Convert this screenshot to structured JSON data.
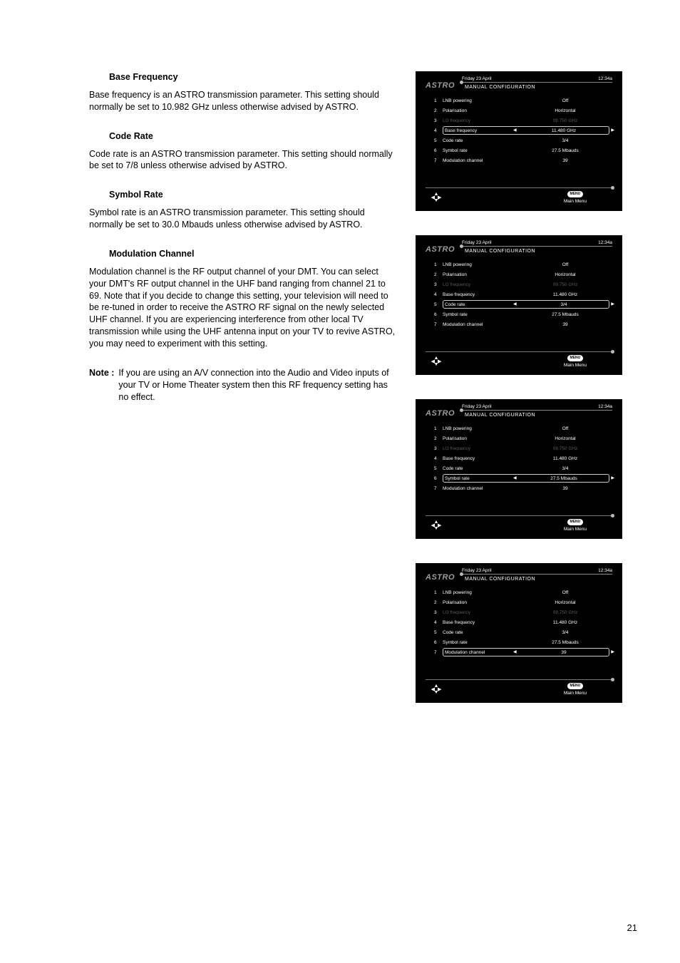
{
  "page_number": "21",
  "text": {
    "h1": "Base Frequency",
    "p1": "Base frequency is an ASTRO transmission parameter. This setting should normally be set to 10.982 GHz unless otherwise advised by ASTRO.",
    "h2": "Code Rate",
    "p2": "Code rate is an ASTRO transmission parameter. This setting should normally be set to 7/8 unless otherwise advised by ASTRO.",
    "h3": "Symbol Rate",
    "p3": "Symbol rate is an ASTRO transmission parameter. This setting should normally be set to 30.0 Mbauds unless otherwise advised by ASTRO.",
    "h4": "Modulation Channel",
    "p4": "Modulation channel is the RF output channel of your DMT.  You can select your DMT's RF output channel in the UHF band ranging from channel 21 to 69.  Note that if you decide to change this setting, your television will need to be re-tuned in order to receive the ASTRO RF signal on the newly selected UHF channel.  If you are experiencing interference from other local TV transmission while using the UHF antenna input on your TV to revive ASTRO, you may need to experiment with this setting.",
    "note_label": "Note :",
    "note_body": "If you are using an A/V connection into the Audio and Video inputs of your TV or Home Theater system then this RF frequency setting has no effect."
  },
  "screen_common": {
    "brand": "ASTRO",
    "date": "Friday 23 April",
    "time": "12:34a",
    "subtitle": "MANUAL CONFIGURATION",
    "main_menu": "Main Menu",
    "menu_btn": "MENU"
  },
  "screens": [
    {
      "selected": 4,
      "rows": [
        {
          "idx": "1",
          "label": "LNB powering",
          "value": "Off",
          "dim": false
        },
        {
          "idx": "2",
          "label": "Polarisation",
          "value": "Horizontal",
          "dim": false
        },
        {
          "idx": "3",
          "label": "LO frequency",
          "value": "09.750  GHz",
          "dim": true
        },
        {
          "idx": "4",
          "label": "Base frequency",
          "value": "11.480  GHz",
          "dim": false
        },
        {
          "idx": "5",
          "label": "Code rate",
          "value": "3/4",
          "dim": false
        },
        {
          "idx": "6",
          "label": "Symbol rate",
          "value": "27.5  Mbauds",
          "dim": false
        },
        {
          "idx": "7",
          "label": "Modulation channel",
          "value": "39",
          "dim": false
        }
      ]
    },
    {
      "selected": 5,
      "rows": [
        {
          "idx": "1",
          "label": "LNB powering",
          "value": "Off",
          "dim": false
        },
        {
          "idx": "2",
          "label": "Polarisation",
          "value": "Horizontal",
          "dim": false
        },
        {
          "idx": "3",
          "label": "LO frequency",
          "value": "09.750  GHz",
          "dim": true
        },
        {
          "idx": "4",
          "label": "Base frequency",
          "value": "11.480  GHz",
          "dim": false
        },
        {
          "idx": "5",
          "label": "Code rate",
          "value": "3/4",
          "dim": false
        },
        {
          "idx": "6",
          "label": "Symbol rate",
          "value": "27.5  Mbauds",
          "dim": false
        },
        {
          "idx": "7",
          "label": "Modulation channel",
          "value": "39",
          "dim": false
        }
      ]
    },
    {
      "selected": 6,
      "rows": [
        {
          "idx": "1",
          "label": "LNB powering",
          "value": "Off",
          "dim": false
        },
        {
          "idx": "2",
          "label": "Polarisation",
          "value": "Horizontal",
          "dim": false
        },
        {
          "idx": "3",
          "label": "LO frequency",
          "value": "09.750  GHz",
          "dim": true
        },
        {
          "idx": "4",
          "label": "Base frequency",
          "value": "11.480  GHz",
          "dim": false
        },
        {
          "idx": "5",
          "label": "Code rate",
          "value": "3/4",
          "dim": false
        },
        {
          "idx": "6",
          "label": "Symbol rate",
          "value": "27.5  Mbauds",
          "dim": false
        },
        {
          "idx": "7",
          "label": "Modulation channel",
          "value": "39",
          "dim": false
        }
      ]
    },
    {
      "selected": 7,
      "rows": [
        {
          "idx": "1",
          "label": "LNB powering",
          "value": "Off",
          "dim": false
        },
        {
          "idx": "2",
          "label": "Polarisation",
          "value": "Horizontal",
          "dim": false
        },
        {
          "idx": "3",
          "label": "LO frequency",
          "value": "09.750  GHz",
          "dim": true
        },
        {
          "idx": "4",
          "label": "Base frequency",
          "value": "11.480  GHz",
          "dim": false
        },
        {
          "idx": "5",
          "label": "Code rate",
          "value": "3/4",
          "dim": false
        },
        {
          "idx": "6",
          "label": "Symbol rate",
          "value": "27.5  Mbauds",
          "dim": false
        },
        {
          "idx": "7",
          "label": "Modulation channel",
          "value": "39",
          "dim": false
        }
      ]
    }
  ]
}
